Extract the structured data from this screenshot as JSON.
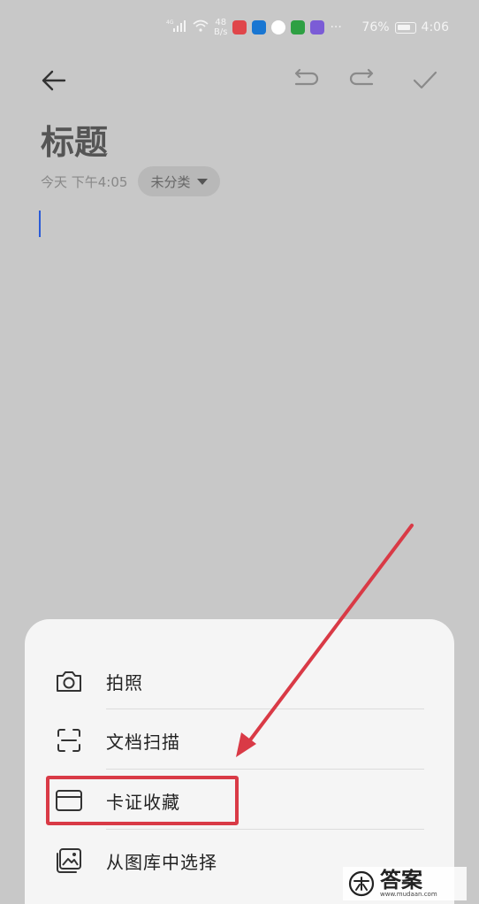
{
  "status_bar": {
    "network": "4G",
    "speed_value": "48",
    "speed_unit": "B/s",
    "more": "···",
    "battery": "76%",
    "time": "4:06",
    "app_colors": [
      "#e0464a",
      "#1976d2",
      "#ffffff",
      "#2ea043",
      "#7b5cd6"
    ]
  },
  "note": {
    "title": "标题",
    "timestamp": "今天 下午4:05",
    "category": "未分类"
  },
  "sheet": {
    "items": [
      {
        "label": "拍照",
        "icon": "camera-icon"
      },
      {
        "label": "文档扫描",
        "icon": "scan-icon"
      },
      {
        "label": "卡证收藏",
        "icon": "card-icon"
      },
      {
        "label": "从图库中选择",
        "icon": "gallery-icon"
      }
    ]
  },
  "annotation": {
    "color": "#d93a46",
    "highlighted_item": "卡证收藏"
  },
  "watermark": {
    "text": "答案",
    "sub": "www.mudaan.com"
  }
}
